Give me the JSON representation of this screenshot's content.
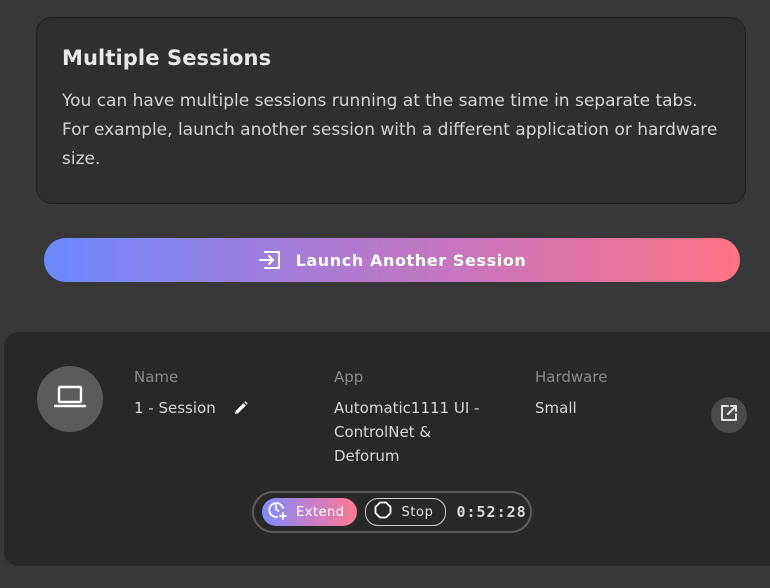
{
  "info": {
    "title": "Multiple Sessions",
    "text": "You can have multiple sessions running at the same time in separate tabs. For example, launch another session with a different application or hardware size."
  },
  "launch_button": {
    "label": "Launch Another Session",
    "icon": "enter-icon"
  },
  "session": {
    "avatar_icon": "laptop-icon",
    "name_label": "Name",
    "name_value": "1 - Session",
    "edit_icon": "pencil-icon",
    "app_label": "App",
    "app_value": "Automatic1111 UI - ControlNet & Deforum",
    "hardware_label": "Hardware",
    "hardware_value": "Small",
    "open_icon": "external-link-icon",
    "controls": {
      "extend_label": "Extend",
      "extend_icon": "clock-plus-icon",
      "stop_label": "Stop",
      "stop_icon": "stop-octagon-icon",
      "timer": "0:52:28"
    }
  },
  "colors": {
    "background": "#383838",
    "card": "#2f2f2f",
    "gradient_start": "#6e88ff",
    "gradient_end": "#ff7384"
  }
}
